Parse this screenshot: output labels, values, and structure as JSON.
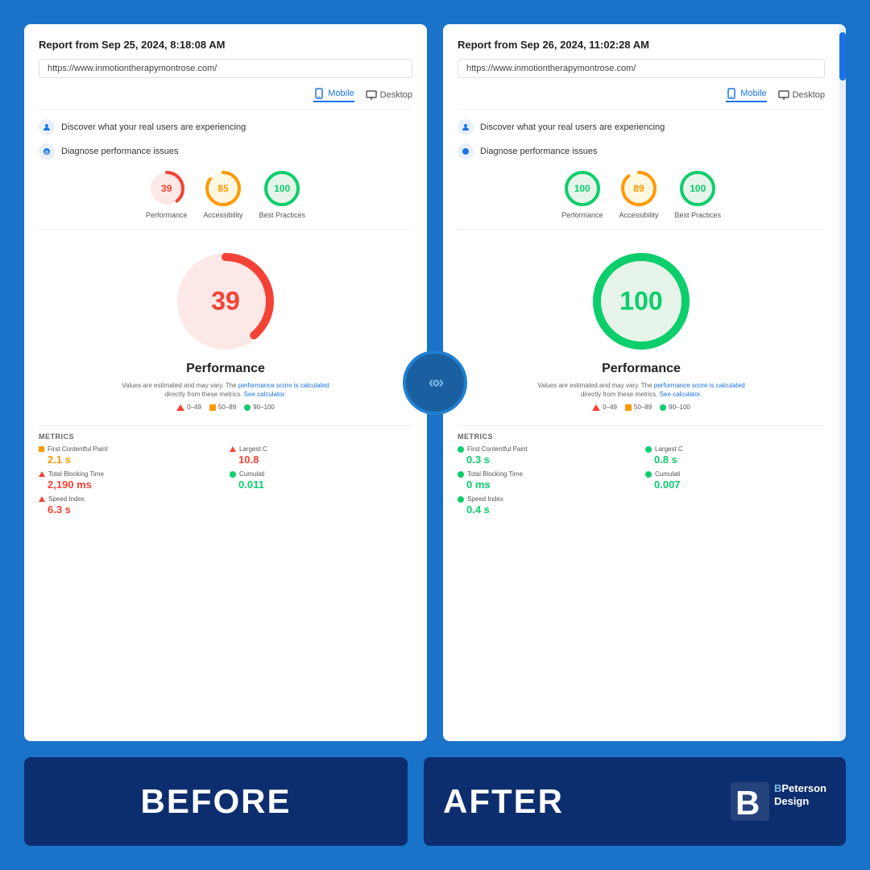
{
  "background_color": "#1a72c9",
  "before_panel": {
    "report_title": "Report from Sep 25, 2024, 8:18:08 AM",
    "url": "https://www.inmotiontherapymontrose.com/",
    "tabs": [
      {
        "label": "Mobile",
        "active": true
      },
      {
        "label": "Desktop",
        "active": false
      }
    ],
    "discover_text": "Discover what your real users are experiencing",
    "diagnose_text": "Diagnose performance issues",
    "scores": [
      {
        "value": 39,
        "label": "Performance",
        "color": "#f44336",
        "bg": "#fce8e6"
      },
      {
        "value": 85,
        "label": "Accessibility",
        "color": "#ff9800",
        "bg": "#fff3e0"
      },
      {
        "value": 100,
        "label": "Best Practices",
        "color": "#0cce6b",
        "bg": "#e6f4ea"
      }
    ],
    "big_score": {
      "value": 39,
      "label": "Performance",
      "color": "#f44336",
      "bg": "#fce8e6"
    },
    "score_note": "Values are estimated and may vary. The performance score is calculated\ndirectly from these metrics. See calculator.",
    "legend": [
      "0–49",
      "50–89",
      "90–100"
    ],
    "metrics": [
      {
        "name": "First Contentful Paint",
        "value": "2.1 s",
        "type": "orange"
      },
      {
        "name": "Largest C",
        "value": "10.8",
        "type": "red",
        "truncated": true
      },
      {
        "name": "Total Blocking Time",
        "value": "2,190 ms",
        "type": "red"
      },
      {
        "name": "Cumulati",
        "value": "0.011",
        "type": "green",
        "truncated": true
      },
      {
        "name": "Speed Index",
        "value": "6.3 s",
        "type": "red"
      }
    ]
  },
  "after_panel": {
    "report_title": "Report from Sep 26, 2024, 11:02:28 AM",
    "url": "https://www.inmotiontherapymontrose.com/",
    "tabs": [
      {
        "label": "Mobile",
        "active": true
      },
      {
        "label": "Desktop",
        "active": false
      }
    ],
    "discover_text": "Discover what your real users are experiencing",
    "diagnose_text": "Diagnose performance issues",
    "scores": [
      {
        "value": 100,
        "label": "Performance",
        "color": "#0cce6b",
        "bg": "#e6f4ea"
      },
      {
        "value": 89,
        "label": "Accessibility",
        "color": "#ff9800",
        "bg": "#fff3e0"
      },
      {
        "value": 100,
        "label": "Best Practices",
        "color": "#0cce6b",
        "bg": "#e6f4ea"
      }
    ],
    "big_score": {
      "value": 100,
      "label": "Performance",
      "color": "#0cce6b",
      "bg": "#e6f4ea"
    },
    "score_note": "Values are estimated and may vary. The performance score is calculated\ndirectly from these metrics. See calculator.",
    "legend": [
      "0–49",
      "50–89",
      "90–100"
    ],
    "metrics": [
      {
        "name": "First Contentful Paint",
        "value": "0.3 s",
        "type": "green"
      },
      {
        "name": "Largest C",
        "value": "0.8 s",
        "type": "green",
        "truncated": true
      },
      {
        "name": "Total Blocking Time",
        "value": "0 ms",
        "type": "green"
      },
      {
        "name": "Cumulati",
        "value": "0.007",
        "type": "green",
        "truncated": true
      },
      {
        "name": "Speed Index",
        "value": "0.4 s",
        "type": "green"
      }
    ]
  },
  "center_divider": {
    "left_arrows": "«",
    "right_arrows": "»"
  },
  "before_label": "BEFORE",
  "after_label": "AFTER",
  "brand": {
    "letter": "B",
    "name_part1": "B",
    "name_part2": "Peterson",
    "name_part3": "Design"
  }
}
